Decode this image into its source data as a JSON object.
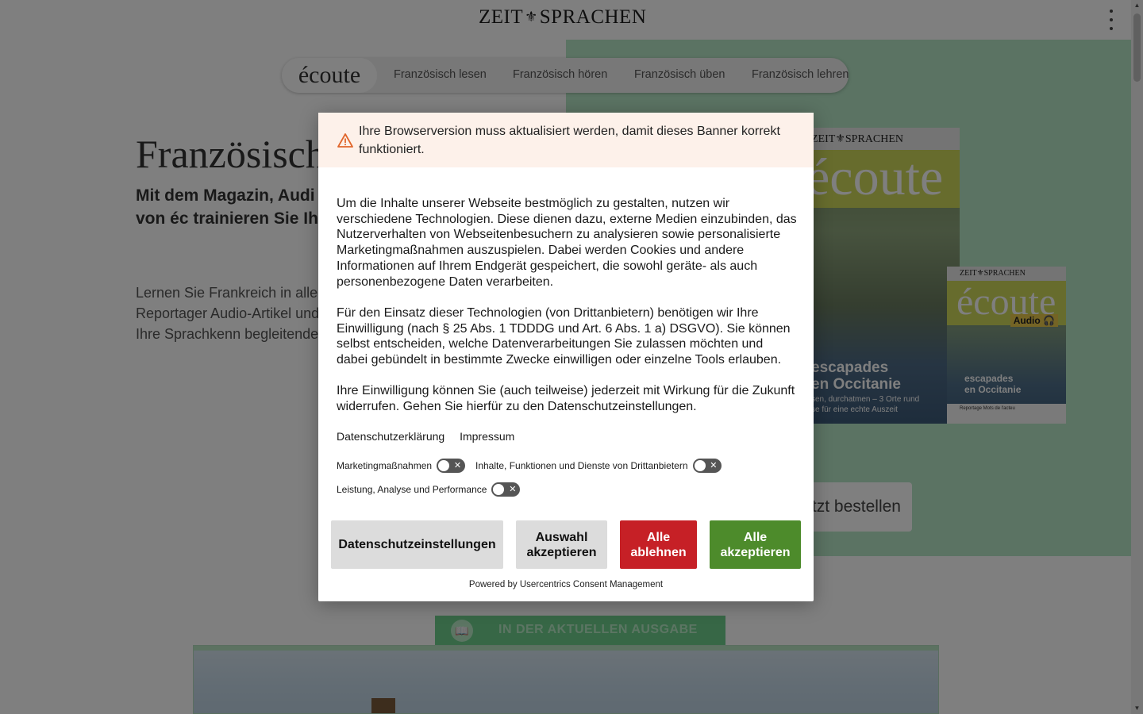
{
  "header": {
    "brand_left": "ZEIT",
    "brand_crest": "⚜",
    "brand_right": "SPRACHEN"
  },
  "subnav": {
    "logo": "écoute",
    "items": [
      {
        "label": "Französisch lesen"
      },
      {
        "label": "Französisch hören"
      },
      {
        "label": "Französisch üben"
      },
      {
        "label": "Französisch lehren"
      }
    ]
  },
  "hero": {
    "title": "Französisch",
    "lead": "Mit dem Magazin, Audi dem Übungsheft von éc trainieren Sie Ihr Franz nebenbei.",
    "body": "Lernen Sie Frankreich in alle kennen – durch Reportager Audio-Artikel und mehr – ur gleichzeitig Ihre Sprachkenn begleitende Übungen und E"
  },
  "covers": {
    "main": {
      "masthead": "ZEIT⚜SPRACHEN",
      "title": "écoute",
      "headline": "escapades\nen Occitanie",
      "subline": "sen, durchatmen – 3 Orte rund\nse für eine echte Auszeit"
    },
    "audio": {
      "masthead": "ZEIT⚜SPRACHEN",
      "title": "écoute",
      "badge": "Audio 🎧",
      "headline": "escapades\nen Occitanie",
      "footer": "Reportage   Mots de l'acteu"
    }
  },
  "order_button": "tzt bestellen",
  "issue": {
    "tab_label": "IN DER AKTUELLEN AUSGABE",
    "book_icon": "📖"
  },
  "consent": {
    "warning": "Ihre Browserversion muss aktualisiert werden, damit dieses Banner korrekt funktioniert.",
    "paragraphs": [
      "Um die Inhalte unserer Webseite bestmöglich zu gestalten, nutzen wir verschiedene Technologien. Diese dienen dazu, externe Medien einzubinden, das Nutzerverhalten von Webseitenbesuchern zu analysieren sowie personalisierte Marketingmaßnahmen auszuspielen. Dabei werden Cookies und andere Informationen auf Ihrem Endgerät gespeichert, die sowohl geräte- als auch personenbezogene Daten verarbeiten.",
      "Für den Einsatz dieser Technologien (von Drittanbietern) benötigen wir Ihre Einwilligung (nach § 25 Abs. 1 TDDDG und Art. 6 Abs. 1 a) DSGVO). Sie können selbst entscheiden, welche Datenverarbeitungen Sie zulassen möchten und dabei gebündelt in bestimmte Zwecke einwilligen oder einzelne Tools erlauben.",
      "Ihre Einwilligung können Sie (auch teilweise) jederzeit mit Wirkung für die Zukunft widerrufen. Gehen Sie hierfür zu den Datenschutzeinstellungen."
    ],
    "links": {
      "privacy": "Datenschutzerklärung",
      "imprint": "Impressum"
    },
    "toggles": [
      {
        "label": "Marketingmaßnahmen",
        "state": "off"
      },
      {
        "label": "Inhalte, Funktionen und Dienste von Drittanbietern",
        "state": "off"
      },
      {
        "label": "Leistung, Analyse und Performance",
        "state": "off"
      }
    ],
    "toggle_symbol": "✕",
    "buttons": {
      "settings": "Datenschutzeinstellungen",
      "select": "Auswahl akzeptieren",
      "deny": "Alle ablehnen",
      "accept": "Alle akzeptieren"
    },
    "powered_by": "Powered by Usercentrics Consent Management"
  },
  "colors": {
    "green_panel": "#b6e6c6",
    "issue_tab": "#6fcf8d",
    "deny": "#c62026",
    "accept": "#4d8b2b",
    "warning_bg": "#fdf1ea",
    "warning_icon": "#e0662c"
  },
  "icons": {
    "warning": "warning-triangle-icon",
    "menu": "kebab-menu-icon",
    "book": "book-icon"
  }
}
